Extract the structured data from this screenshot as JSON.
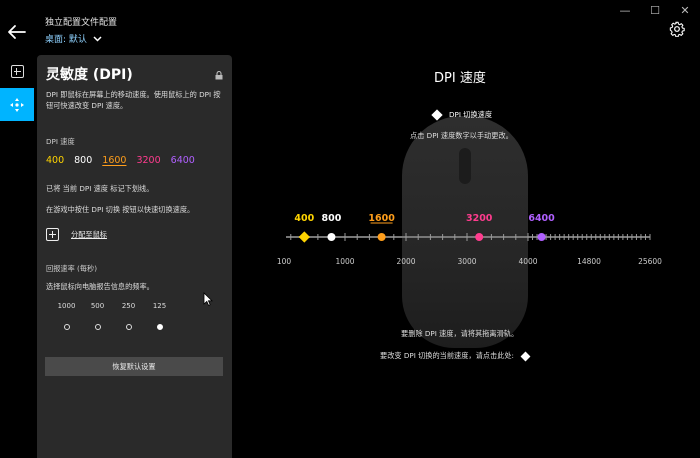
{
  "window": {
    "minimize": "—",
    "maximize": "☐",
    "close": "✕"
  },
  "header": {
    "title": "独立配置文件配置",
    "profile": "桌面: 默认"
  },
  "panel": {
    "title": "灵敏度 (DPI)",
    "description": "DPI 即鼠标在屏幕上的移动速度。使用鼠标上的 DPI 按钮可快速改变 DPI 速度。",
    "dpi_label": "DPI 速度",
    "dpi_values": [
      {
        "value": "400",
        "color": "#ffd400"
      },
      {
        "value": "800",
        "color": "#ffffff"
      },
      {
        "value": "1600",
        "color": "#ff9e1b"
      },
      {
        "value": "3200",
        "color": "#ff3c8e"
      },
      {
        "value": "6400",
        "color": "#b060ff"
      }
    ],
    "current_info": "已将 当前 DPI 速度 标记下划线。",
    "shift_info": "在游戏中按住 DPI 切换 按钮以快速切换速度。",
    "assign_label": "分配至鼠标",
    "report_rate_label": "回报速率 (每秒)",
    "report_rate_desc": "选择鼠标向电脑报告信息的频率。",
    "rates": [
      "1000",
      "500",
      "250",
      "125"
    ],
    "selected_rate": "125",
    "reset_label": "恢复默认设置"
  },
  "main": {
    "title": "DPI 速度",
    "shift_legend": "DPI 切换速度",
    "click_hint": "点击 DPI 速度数字以手动更改。",
    "remove_hint": "要删除 DPI 速度，请将其拖离滑轨。",
    "change_hint": "要改变 DPI 切换的当前速度，请点击此处:"
  },
  "chart_data": {
    "type": "scatter",
    "x_ticks": [
      "100",
      "1000",
      "2000",
      "3000",
      "4000",
      "14800",
      "25600"
    ],
    "points": [
      {
        "label": "400",
        "dpi": 400,
        "color": "#ffd400",
        "shape": "diamond"
      },
      {
        "label": "800",
        "dpi": 800,
        "color": "#ffffff",
        "shape": "circle"
      },
      {
        "label": "1600",
        "dpi": 1600,
        "color": "#ff9e1b",
        "shape": "circle",
        "current": true
      },
      {
        "label": "3200",
        "dpi": 3200,
        "color": "#ff3c8e",
        "shape": "circle"
      },
      {
        "label": "6400",
        "dpi": 6400,
        "color": "#b060ff",
        "shape": "circle"
      }
    ]
  }
}
